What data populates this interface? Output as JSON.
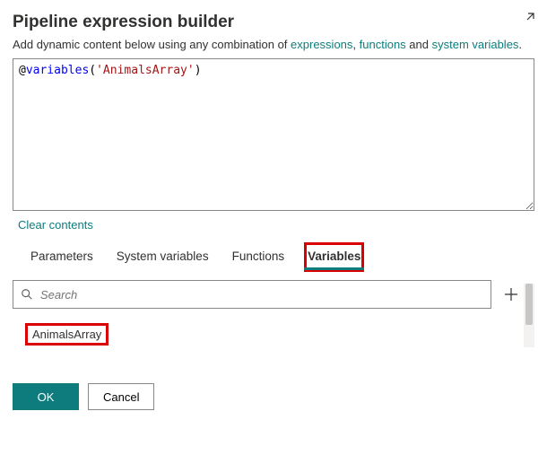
{
  "title": "Pipeline expression builder",
  "subtitle": {
    "prefix": "Add dynamic content below using any combination of ",
    "link_expr": "expressions",
    "sep1": ", ",
    "link_fn": "functions",
    "sep2": " and ",
    "link_sys": "system variables",
    "suffix": "."
  },
  "editor": {
    "at": "@",
    "fn": "variables",
    "open": "(",
    "str": "'AnimalsArray'",
    "close": ")"
  },
  "clear_label": "Clear contents",
  "tabs": {
    "parameters": "Parameters",
    "system_vars": "System variables",
    "functions": "Functions",
    "variables": "Variables"
  },
  "search": {
    "placeholder": "Search"
  },
  "items": [
    {
      "label": "AnimalsArray"
    }
  ],
  "buttons": {
    "ok": "OK",
    "cancel": "Cancel"
  }
}
